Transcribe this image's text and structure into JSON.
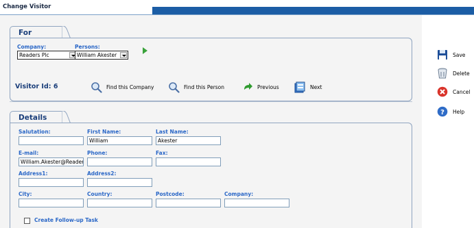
{
  "window": {
    "title": "Change Visitor"
  },
  "for_section": {
    "tab_label": "For",
    "company_label": "Company:",
    "company_value": "Readers Plc",
    "persons_label": "Persons:",
    "persons_value": "William Akester"
  },
  "toolbar": {
    "visitor_id_text": "Visitor Id: 6",
    "find_company": "Find this Company",
    "find_person": "Find this Person",
    "previous": "Previous",
    "next": "Next"
  },
  "details": {
    "tab_label": "Details",
    "salutation_label": "Salutation:",
    "salutation_value": "",
    "first_name_label": "First Name:",
    "first_name_value": "William",
    "last_name_label": "Last Name:",
    "last_name_value": "Akester",
    "email_label": "E-mail:",
    "email_value": "William.Akester@Reader",
    "phone_label": "Phone:",
    "phone_value": "",
    "fax_label": "Fax:",
    "fax_value": "",
    "address1_label": "Address1:",
    "address1_value": "",
    "address2_label": "Address2:",
    "address2_value": "",
    "city_label": "City:",
    "city_value": "",
    "country_label": "Country:",
    "country_value": "",
    "postcode_label": "Postcode:",
    "postcode_value": "",
    "company_label": "Company:",
    "company_value": "",
    "followup_label": "Create Follow-up Task"
  },
  "actions": {
    "save": "Save",
    "delete": "Delete",
    "cancel": "Cancel",
    "help": "Help"
  },
  "colors": {
    "accent_blue": "#1b5da5",
    "label_blue": "#2a67c7",
    "heading_blue": "#1a3e7a",
    "next_arrow_green": "#39a23a"
  }
}
